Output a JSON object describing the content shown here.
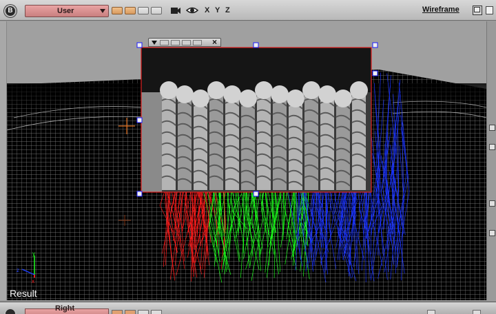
{
  "toolbar": {
    "badge": "B",
    "view_select": "User",
    "axes": [
      "X",
      "Y",
      "Z"
    ],
    "shading_mode": "Wireframe"
  },
  "viewport": {
    "label": "Result",
    "icons": [
      "camera-icon",
      "eye-icon",
      "crosshair-icon",
      "axis-gizmo-icon"
    ],
    "colors": {
      "ground": "#000000",
      "grid": "#8c8c8c",
      "red_strands": "#ff1a1a",
      "green_strands": "#1aff1a",
      "blue_strands": "#1a33ff",
      "frame": "#e02020",
      "handle": "#1a1aff"
    }
  },
  "float_window": {
    "close_label": "×"
  },
  "bottom_bar": {
    "badge": "B",
    "view_select": "Right"
  }
}
